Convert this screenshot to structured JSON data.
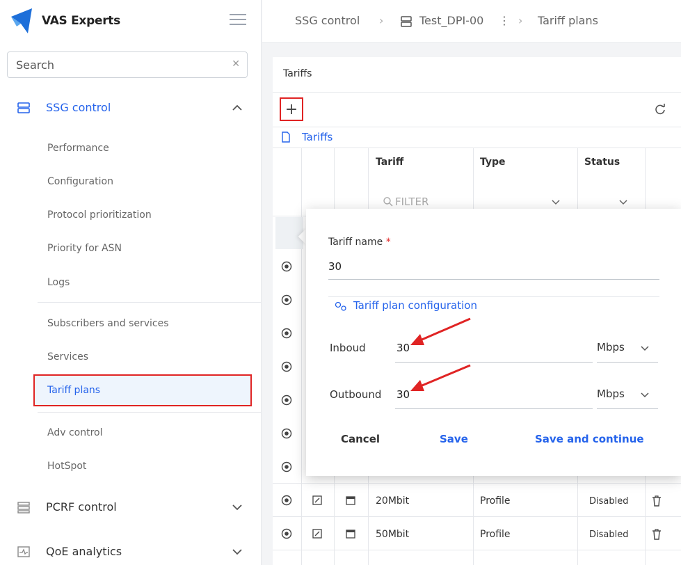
{
  "brand": {
    "name": "VAS Experts"
  },
  "search": {
    "placeholder": "Search"
  },
  "sidebar": {
    "ssg_control": "SSG control",
    "items": [
      "Performance",
      "Configuration",
      "Protocol prioritization",
      "Priority for ASN",
      "Logs"
    ],
    "items2": [
      "Subscribers and services",
      "Services",
      "Tariff plans"
    ],
    "items3": [
      "Adv control",
      "HotSpot"
    ],
    "pcrf_control": "PCRF control",
    "qoe_analytics": "QoE analytics"
  },
  "breadcrumb": {
    "first": "SSG control",
    "second": "Test_DPI-00",
    "third": "Tariff plans"
  },
  "panel": {
    "title": "Tariffs",
    "tab": "Tariffs",
    "col_tariff": "Tariff",
    "col_type": "Type",
    "col_status": "Status",
    "filter_placeholder": "FILTER"
  },
  "rows": [
    {
      "tariff": "20Mbit",
      "type": "Profile",
      "status": "Disabled"
    },
    {
      "tariff": "50Mbit",
      "type": "Profile",
      "status": "Disabled"
    }
  ],
  "dialog": {
    "name_label": "Tariff name",
    "required_mark": "*",
    "name_value": "30",
    "config_link": "Tariff plan configuration",
    "inbound_label": "Inboud",
    "inbound_value": "30",
    "inbound_unit": "Mbps",
    "outbound_label": "Outbound",
    "outbound_value": "30",
    "outbound_unit": "Mbps",
    "cancel": "Cancel",
    "save": "Save",
    "save_continue": "Save and continue"
  },
  "colors": {
    "accent": "#2563eb",
    "highlight": "#e02424"
  }
}
